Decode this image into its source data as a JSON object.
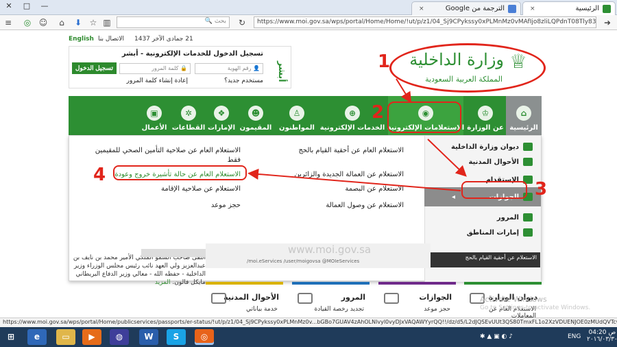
{
  "browser": {
    "tabs": [
      {
        "title": "الرئيسية",
        "close": "×"
      },
      {
        "title": "الترجمة من Google",
        "close": "×"
      }
    ],
    "window_controls": [
      "—",
      "□",
      "✕"
    ],
    "search_placeholder": "بحث",
    "url": "https://www.moi.gov.sa/wps/portal/Home/Home/!ut/p/z1/04_Sj9CPykssy0xPLMnMz0vMAfIjo8zliLQPdnT08Tly83Q0dzQwcPc2N_A08"
  },
  "topbar": {
    "date": "21 جمادى الآخر 1437",
    "contact": "الاتصال بنا",
    "english": "English"
  },
  "login": {
    "title": "تسجيل الدخول للخدمات الإلكترونية - أبشر",
    "id_placeholder": "رقم الهوية",
    "password_placeholder": "كلمة المرور",
    "button": "تسجيل الدخول",
    "new_user": "مستخدم جديد؟",
    "reset": "إعادة إنشاء كلمة المرور",
    "brand": "أبشر"
  },
  "logo": {
    "title": "وزارة الداخلية",
    "subtitle": "المملكة العربية السعودية"
  },
  "nav": [
    {
      "label": "الرئيسية"
    },
    {
      "label": "عن الوزارة"
    },
    {
      "label": "الاستعلامات الإلكترونية"
    },
    {
      "label": "الخدمات الإلكترونية"
    },
    {
      "label": "المواطنون"
    },
    {
      "label": "المقيمون"
    },
    {
      "label": "الإمارات"
    },
    {
      "label": "القطاعات"
    },
    {
      "label": "الأعمال"
    }
  ],
  "mega_side": [
    {
      "label": "ديوان وزارة الداخلية"
    },
    {
      "label": "الأحوال المدنية"
    },
    {
      "label": "الإستقدام"
    },
    {
      "label": "الجوازات"
    },
    {
      "label": "المرور"
    },
    {
      "label": "إمارات المناطق"
    }
  ],
  "mega_links_mid": [
    "الاستعلام العام عن أحقية القيام بالحج",
    "الاستعلام عن العمالة الجديدة والزائرين",
    "الاستعلام عن البصمة",
    "الاستعلام عن وصول العمالة"
  ],
  "mega_links_left": [
    "الاستعلام العام عن صلاحية التأمين الصحي للمقيمين فقط",
    "الاستعلام العام عن حالة تأشيرة خروج وعودة",
    "الاستعلام عن صلاحية الإقامة",
    "حجز موعد"
  ],
  "annotations": [
    "1",
    "2",
    "3",
    "4"
  ],
  "banner": {
    "site": "www.moi.gov.sa",
    "social": "/moi.eServices   /user/moigovsa   @MOIeServices",
    "caption": "الاستعلام عن أحقية القيام بالحج"
  },
  "news": {
    "text": "التقى صاحب السمو الملكي الأمير محمد بن نايف بن عبدالعزيز ولي العهد نائب رئيس مجلس الوزراء وزير الداخلية - حفظه الله - معالي وزير الدفاع البريطاني مايكل فالون.",
    "more": "المزيد"
  },
  "cards": [
    {
      "title": "ديوان الوزارة",
      "sub": "الاستعلام العام عن المعاملات"
    },
    {
      "title": "الجوازات",
      "sub": "حجز موعد"
    },
    {
      "title": "المرور",
      "sub": "تجديد رخصة القيادة"
    },
    {
      "title": "الأحوال المدنية",
      "sub": "خدمة بياناتي"
    }
  ],
  "watermark": [
    "Activate Windows",
    "Go to Settings to activate Windows."
  ],
  "status_url": "https://www.moi.gov.sa/wps/portal/Home/publicservices/passports/er-status/!ut/p/z1/04_Sj9CPykssy0xPLMnMz0v...bGBo7GUAV4zAhOLNlvyl0vyDJxVAQAWYyrQQ!!/dz/d5/L2dJQSEvUUt3QS80TmxFL1o2XzVDUENJOE0zMUdQVTcwMkY3NEpDNks4RzA0/",
  "taskbar": {
    "lang": "ENG",
    "time": "04:20 ص",
    "date": "٢٠١٦/٠٣/٣٠"
  },
  "colors": {
    "green": "#2d8f33",
    "red": "#e1251b",
    "grey": "#8b9090"
  }
}
